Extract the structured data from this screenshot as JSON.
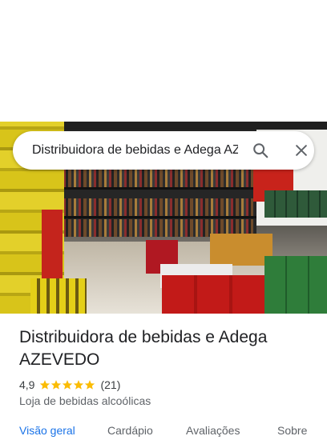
{
  "search": {
    "query": "Distribuidora de bebidas e Adega AZEVEDO",
    "search_icon": "search-icon",
    "close_icon": "close-icon"
  },
  "hero": {
    "image": "store-photo",
    "description_visible": false
  },
  "place": {
    "name": "Distribuidora de bebidas e Adega AZEVEDO",
    "rating": "4,9",
    "rating_value": 4.9,
    "stars_max": 5,
    "review_count": "(21)",
    "category": "Loja de bebidas alcoólicas"
  },
  "tabs": [
    {
      "label": "Visão geral",
      "active": true
    },
    {
      "label": "Cardápio",
      "active": false
    },
    {
      "label": "Avaliações",
      "active": false
    },
    {
      "label": "Sobre",
      "active": false
    }
  ],
  "colors": {
    "accent": "#1a73e8",
    "star": "#fbbc04",
    "text_primary": "#202124",
    "text_secondary": "#5f6368"
  }
}
